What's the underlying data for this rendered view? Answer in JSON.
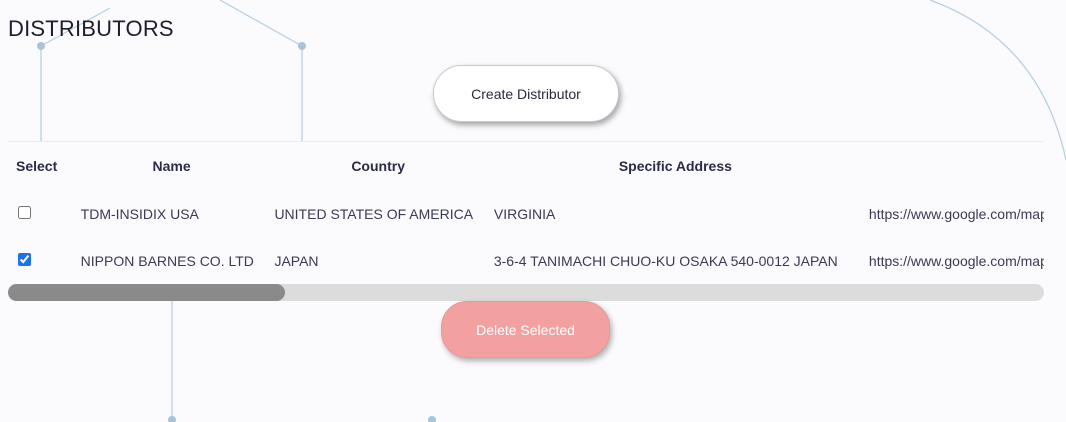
{
  "page": {
    "title": "DISTRIBUTORS"
  },
  "toolbar": {
    "create_label": "Create Distributor",
    "delete_label": "Delete Selected"
  },
  "table": {
    "headers": {
      "select": "Select",
      "name": "Name",
      "country": "Country",
      "address": "Specific Address"
    },
    "rows": [
      {
        "selected": false,
        "name": "TDM-INSIDIX USA",
        "country": "UNITED STATES OF AMERICA",
        "address": "VIRGINIA",
        "link": "https://www.google.com/maps"
      },
      {
        "selected": true,
        "name": "NIPPON BARNES CO. LTD",
        "country": "JAPAN",
        "address": "3-6-4 TANIMACHI CHUO-KU OSAKA 540-0012 JAPAN",
        "link": "https://www.google.com/maps"
      }
    ]
  },
  "colors": {
    "background": "#fbfafc",
    "network_lines": "#b4cfe0",
    "delete_button": "#f2a0a0",
    "scroll_thumb": "#8a8a8a",
    "scroll_track": "#dcdcdc"
  }
}
